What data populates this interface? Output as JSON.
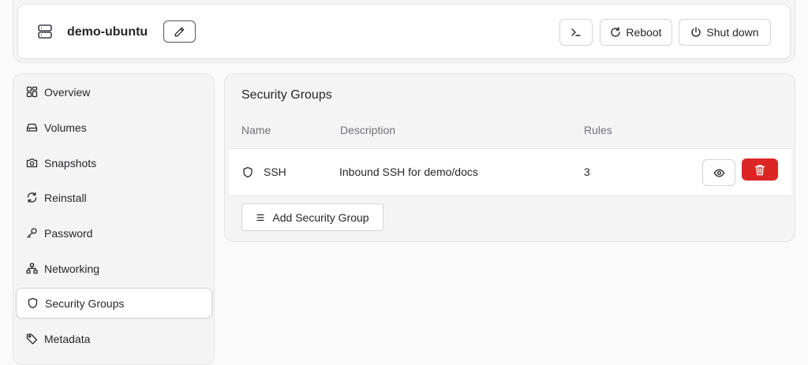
{
  "header": {
    "server_name": "demo-ubuntu",
    "buttons": {
      "reboot": "Reboot",
      "shutdown": "Shut down"
    }
  },
  "sidebar": {
    "items": [
      {
        "label": "Overview",
        "icon": "grid-icon"
      },
      {
        "label": "Volumes",
        "icon": "hard-drive-icon"
      },
      {
        "label": "Snapshots",
        "icon": "camera-icon"
      },
      {
        "label": "Reinstall",
        "icon": "refresh-icon"
      },
      {
        "label": "Password",
        "icon": "key-icon"
      },
      {
        "label": "Networking",
        "icon": "network-icon"
      },
      {
        "label": "Security Groups",
        "icon": "shield-icon"
      },
      {
        "label": "Metadata",
        "icon": "tag-icon"
      }
    ],
    "active": "Security Groups"
  },
  "security_groups": {
    "title": "Security Groups",
    "columns": [
      "Name",
      "Description",
      "Rules"
    ],
    "rows": [
      {
        "name": "SSH",
        "description": "Inbound SSH for demo/docs",
        "rules": "3"
      }
    ],
    "add_button": "Add Security Group"
  },
  "colors": {
    "danger": "#dc2626",
    "background": "#fafafa",
    "card": "#f4f4f5"
  }
}
